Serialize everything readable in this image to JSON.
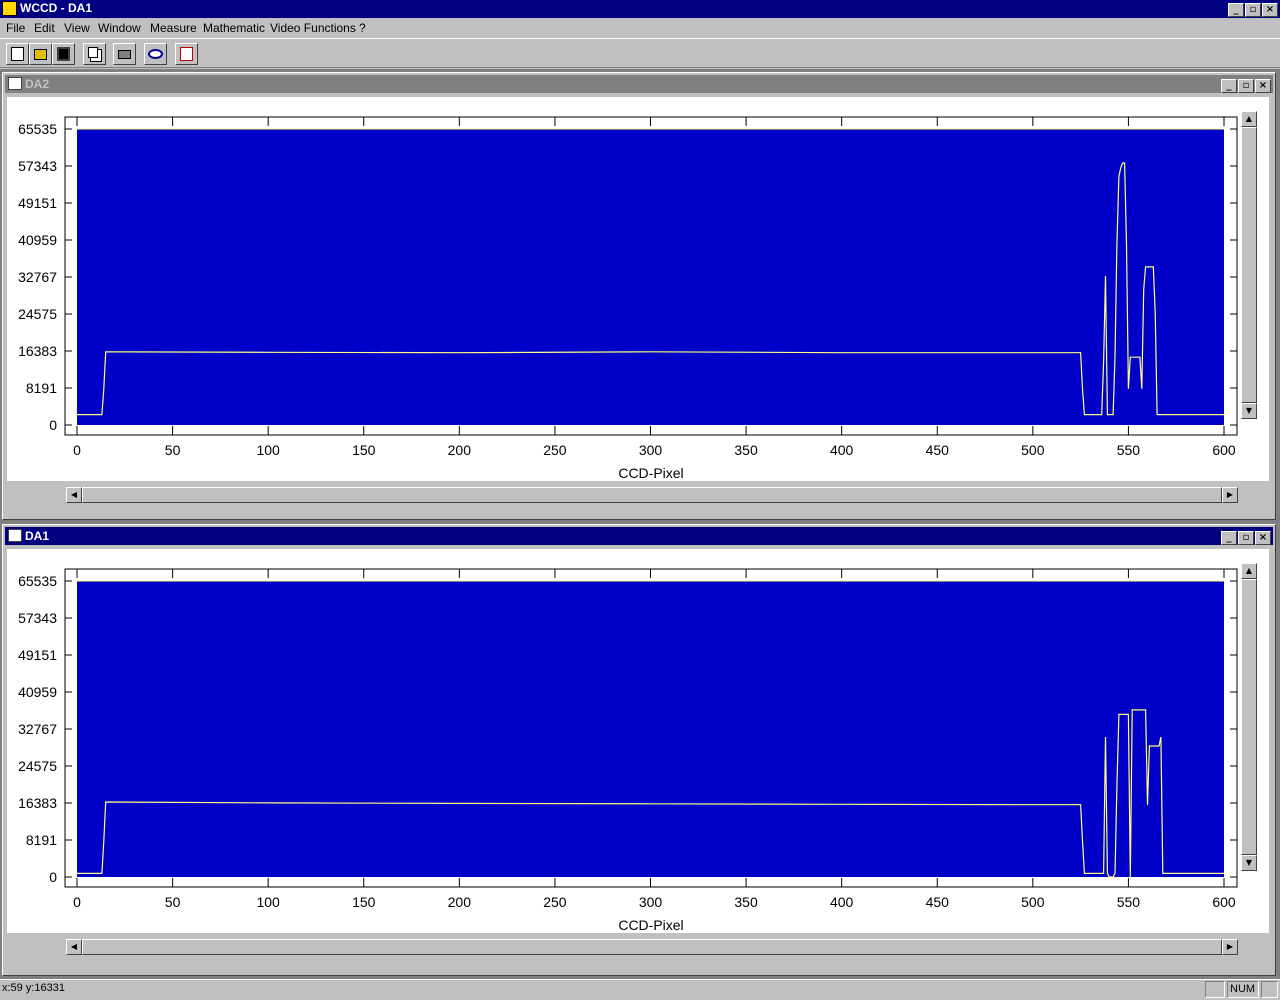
{
  "window": {
    "title": "WCCD - DA1",
    "min": "_",
    "max": "▫",
    "close": "×"
  },
  "menu": [
    {
      "label": "File",
      "x": 6
    },
    {
      "label": "Edit",
      "x": 34
    },
    {
      "label": "View",
      "x": 64
    },
    {
      "label": "Window",
      "x": 98
    },
    {
      "label": "Measure",
      "x": 150
    },
    {
      "label": "Mathematic",
      "x": 203
    },
    {
      "label": "Video Functions",
      "x": 270
    },
    {
      "label": "?",
      "x": 359
    }
  ],
  "toolbar": [
    "new-file-icon",
    "open-folder-icon",
    "save-disk-icon",
    "copy-icon",
    "print-icon",
    "view-eye-icon",
    "video-signal-icon"
  ],
  "windows": [
    {
      "title": "DA2",
      "active": false,
      "chart_data": {
        "type": "line",
        "xlabel": "CCD-Pixel",
        "ylabel": "",
        "xlim": [
          0,
          600
        ],
        "ylim": [
          0,
          65535
        ],
        "xticks": [
          0,
          50,
          100,
          150,
          200,
          250,
          300,
          350,
          400,
          450,
          500,
          550,
          600
        ],
        "yticks": [
          0,
          8191,
          16383,
          24575,
          32767,
          40959,
          49151,
          57343,
          65535
        ],
        "plot_bg": "#0000c8",
        "line_color": "#ffff80",
        "series": [
          {
            "x": [
              0,
              13,
              14,
              15,
              100,
              200,
              300,
              400,
              500,
              525,
              526,
              527,
              536,
              537,
              538,
              539,
              540,
              542,
              543,
              544,
              545,
              546,
              547,
              548,
              549,
              550,
              551,
              552,
              553,
              554,
              555,
              556,
              557,
              558,
              559,
              560,
              561,
              562,
              563,
              564,
              565,
              566,
              567,
              568,
              569,
              570,
              571,
              575,
              600
            ],
            "y": [
              2300,
              2300,
              8000,
              16200,
              16100,
              16000,
              16200,
              16000,
              16000,
              16000,
              8000,
              2300,
              2300,
              14000,
              33000,
              2300,
              2300,
              2300,
              15000,
              40000,
              55000,
              57000,
              58000,
              58000,
              40000,
              8000,
              15000,
              15000,
              15000,
              15000,
              15000,
              15000,
              8000,
              30000,
              35000,
              35000,
              35000,
              35000,
              35000,
              25000,
              2300,
              2300,
              2300,
              2300,
              2300,
              2300,
              2300,
              2300,
              2300
            ]
          }
        ]
      }
    },
    {
      "title": "DA1",
      "active": true,
      "chart_data": {
        "type": "line",
        "xlabel": "CCD-Pixel",
        "ylabel": "",
        "xlim": [
          0,
          600
        ],
        "ylim": [
          0,
          65535
        ],
        "xticks": [
          0,
          50,
          100,
          150,
          200,
          250,
          300,
          350,
          400,
          450,
          500,
          550,
          600
        ],
        "yticks": [
          0,
          8191,
          16383,
          24575,
          32767,
          40959,
          49151,
          57343,
          65535
        ],
        "plot_bg": "#0000c8",
        "line_color": "#ffff80",
        "series": [
          {
            "x": [
              0,
              13,
              14,
              15,
              100,
              200,
              300,
              400,
              500,
              525,
              526,
              527,
              537,
              538,
              539,
              540,
              542,
              543,
              544,
              545,
              546,
              547,
              548,
              549,
              550,
              551,
              552,
              553,
              554,
              555,
              556,
              557,
              558,
              559,
              560,
              561,
              562,
              563,
              564,
              565,
              566,
              567,
              568,
              569,
              570,
              571,
              572,
              575,
              600
            ],
            "y": [
              800,
              800,
              8000,
              16600,
              16400,
              16300,
              16200,
              16100,
              16000,
              16000,
              8000,
              800,
              800,
              31000,
              800,
              0,
              0,
              800,
              20000,
              36000,
              36000,
              36000,
              36000,
              36000,
              36000,
              0,
              37000,
              37000,
              37000,
              37000,
              37000,
              37000,
              37000,
              37000,
              16000,
              29000,
              29000,
              29000,
              29000,
              29000,
              29000,
              31000,
              800,
              800,
              800,
              800,
              800,
              800,
              800
            ]
          }
        ]
      }
    }
  ],
  "status": {
    "coords": "x:59 y:16331",
    "num": "NUM"
  }
}
